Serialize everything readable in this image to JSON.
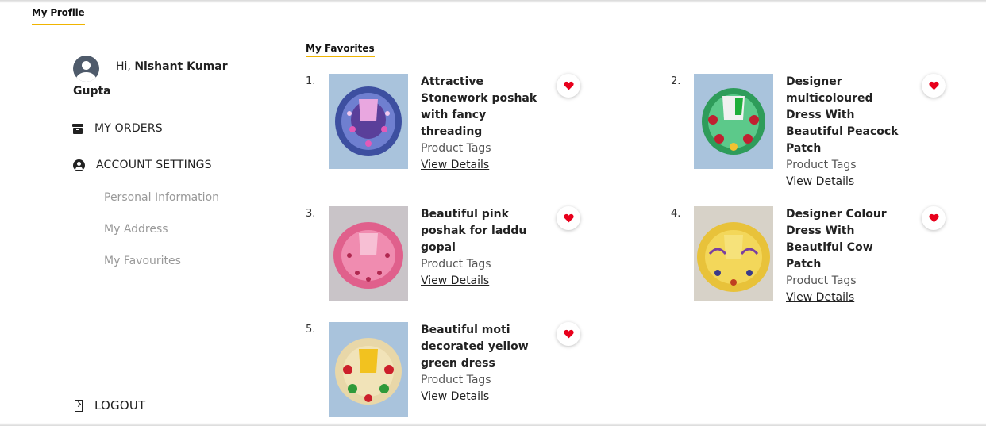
{
  "header": {
    "tab_label": "My Profile"
  },
  "sidebar": {
    "greeting_prefix": "Hi, ",
    "user_first": "Nishant Kumar",
    "user_last": "Gupta",
    "orders_label": "MY ORDERS",
    "account_label": "ACCOUNT SETTINGS",
    "sub_items": [
      "Personal Information",
      "My Address",
      "My Favourites"
    ],
    "logout_label": "LOGOUT"
  },
  "main": {
    "section_title": "My Favorites",
    "items": [
      {
        "num": "1.",
        "title": "Attractive Stonework poshak with fancy threading",
        "tags": "Product Tags",
        "details": "View Details"
      },
      {
        "num": "2.",
        "title": "Designer multicoloured Dress With Beautiful Peacock Patch",
        "tags": "Product Tags",
        "details": "View Details"
      },
      {
        "num": "3.",
        "title": "Beautiful pink poshak for laddu gopal",
        "tags": "Product Tags",
        "details": "View Details"
      },
      {
        "num": "4.",
        "title": "Designer Colour Dress With Beautiful Cow Patch",
        "tags": "Product Tags",
        "details": "View Details"
      },
      {
        "num": "5.",
        "title": "Beautiful moti decorated yellow green dress",
        "tags": "Product Tags",
        "details": "View Details"
      }
    ]
  },
  "colors": {
    "accent": "#f0b400",
    "heart": "#e8001c",
    "thumb_bg": "#a9c3dc"
  }
}
